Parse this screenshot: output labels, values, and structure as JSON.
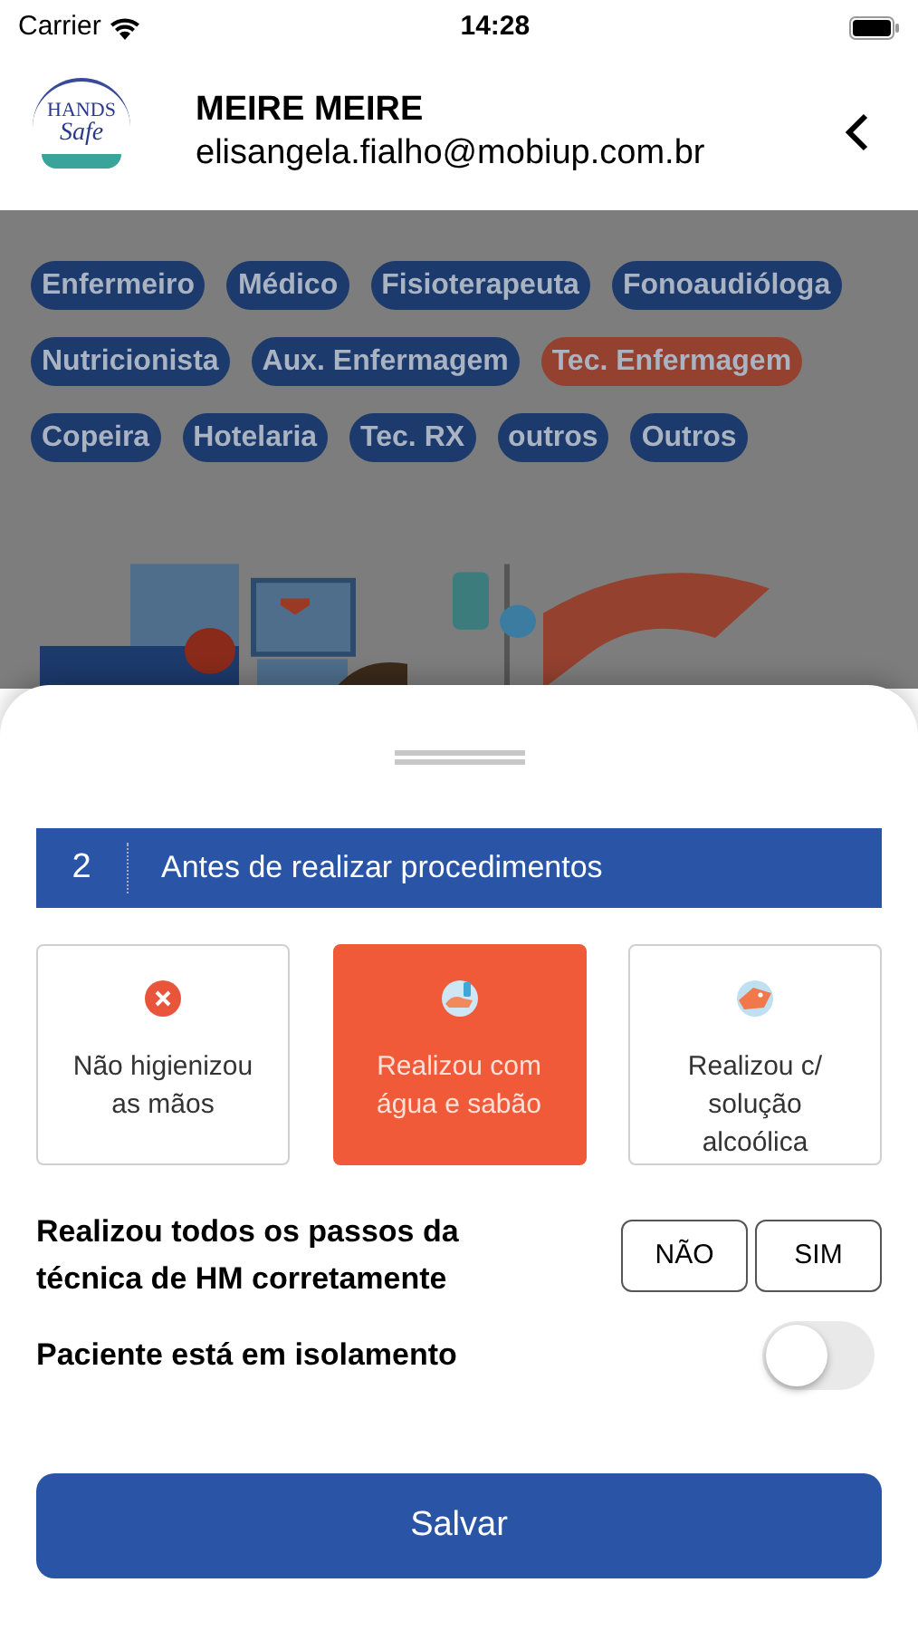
{
  "status_bar": {
    "carrier": "Carrier",
    "time": "14:28"
  },
  "header": {
    "name": "MEIRE MEIRE",
    "email": "elisangela.fialho@mobiup.com.br",
    "logo_line_1": "HANDS",
    "logo_line_2": "Safe"
  },
  "chips": [
    {
      "label": "Enfermeiro",
      "selected": false
    },
    {
      "label": "Médico",
      "selected": false
    },
    {
      "label": "Fisioterapeuta",
      "selected": false
    },
    {
      "label": "Fonoaudióloga",
      "selected": false
    },
    {
      "label": "Nutricionista",
      "selected": false
    },
    {
      "label": "Aux. Enfermagem",
      "selected": false
    },
    {
      "label": "Tec. Enfermagem",
      "selected": true
    },
    {
      "label": "Copeira",
      "selected": false
    },
    {
      "label": "Hotelaria",
      "selected": false
    },
    {
      "label": "Tec. RX",
      "selected": false
    },
    {
      "label": "outros",
      "selected": false
    },
    {
      "label": "Outros",
      "selected": false
    }
  ],
  "sheet": {
    "step_number": "2",
    "step_title": "Antes de realizar procedimentos",
    "options": [
      {
        "kind": "none",
        "label": "Não higienizou as mãos",
        "selected": false
      },
      {
        "kind": "soap",
        "label": "Realizou com água e sabão",
        "selected": true
      },
      {
        "kind": "alcohol",
        "label": "Realizou c/ solução alcoólica",
        "selected": false
      }
    ],
    "technique_question": "Realizou todos os passos da técnica de HM corretamente",
    "technique_answers": [
      {
        "label": "NÃO",
        "selected": false
      },
      {
        "label": "SIM",
        "selected": false
      }
    ],
    "isolation": {
      "label": "Paciente está em isolamento",
      "on": false
    },
    "save_button": "Salvar"
  }
}
